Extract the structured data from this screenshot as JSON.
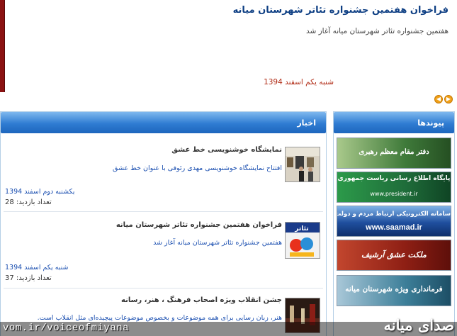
{
  "featured": {
    "title": "فراخوان هفتمین جشنواره تئاتر شهرستان میانه",
    "summary": "هفتمین جشنواره تئاتر شهرستان میانه آغاز شد",
    "date": "شنبه یکم اسفند 1394"
  },
  "news_box": {
    "header": "اخبار",
    "items": [
      {
        "title": "نمایشگاه خوشنویسی خط عشق",
        "link": "افتتاح نمایشگاه خوشنویسی مهدی رئوفی با عنوان خط عشق",
        "date": "یکشنبه دوم اسفند 1394",
        "visits": "تعداد بازدید: 28"
      },
      {
        "title": "فراخوان هفتمین جشنواره تئاتر شهرستان میانه",
        "link": "هفتمین جشنواره تئاتر شهرستان میانه آغاز شد",
        "date": "شنبه یکم اسفند 1394",
        "visits": "تعداد بازدید: 37",
        "thumb_text": "تئاتر"
      },
      {
        "title": "جشن انقلاب ویژه اصحاب فرهنگ ، هنر، رسانه",
        "link": "هنر، زبان رسایی برای همه موضوعات و بخصوص موضوعات پیچیده‌ای مثل انقلاب است."
      }
    ]
  },
  "links_box": {
    "header": "پیوندها",
    "banners": [
      {
        "text": "دفتر مقام معظم رهبری",
        "color": "#2f6b2f"
      },
      {
        "text": "پایگاه اطلاع رسانی ریاست جمهوری",
        "subtext": "www.president.ir",
        "color": "#1e6e3a"
      },
      {
        "text": "سامانه الکترونیکی ارتباط مردم و دولت",
        "subtext": "www.saamad.ir",
        "color": "#1f4f9e"
      },
      {
        "text": "ملکت عشق آرشیف",
        "color": "#8e1f14"
      },
      {
        "text": "فرمانداری ویژه شهرستان میانه",
        "color": "#2d6f8a"
      }
    ]
  },
  "watermark": {
    "url": "vom.ir/voiceofmiyana",
    "logo": "صدای میانه"
  }
}
